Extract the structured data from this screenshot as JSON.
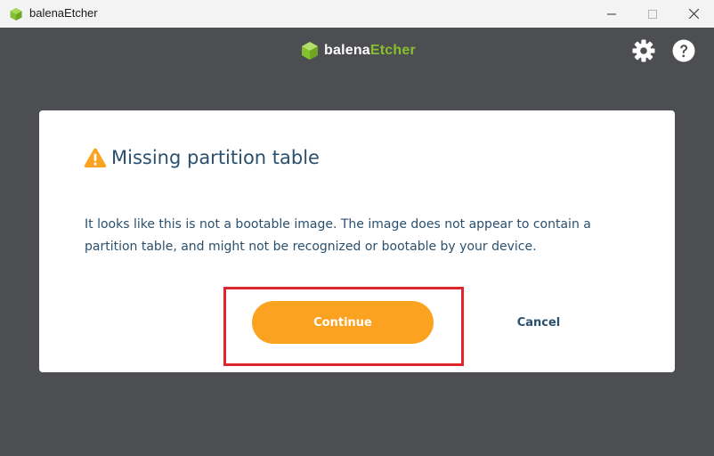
{
  "window": {
    "title": "balenaEtcher",
    "controls": [
      "minimize",
      "maximize",
      "close"
    ]
  },
  "header": {
    "brand_prefix": "balena",
    "brand_suffix": "Etcher",
    "settings_icon": "gear-icon",
    "help_icon": "help-icon"
  },
  "dialog": {
    "title": "Missing partition table",
    "message": "It looks like this is not a bootable image. The image does not appear to contain a partition table, and might not be recognized or bootable by your device.",
    "continue_label": "Continue",
    "cancel_label": "Cancel",
    "warning_icon": "warning-icon"
  },
  "colors": {
    "background": "#4d4e51",
    "accent_orange": "#fca221",
    "brand_green": "#85c12e",
    "text_blue": "#2a506f",
    "highlight_red": "#e0262c"
  }
}
